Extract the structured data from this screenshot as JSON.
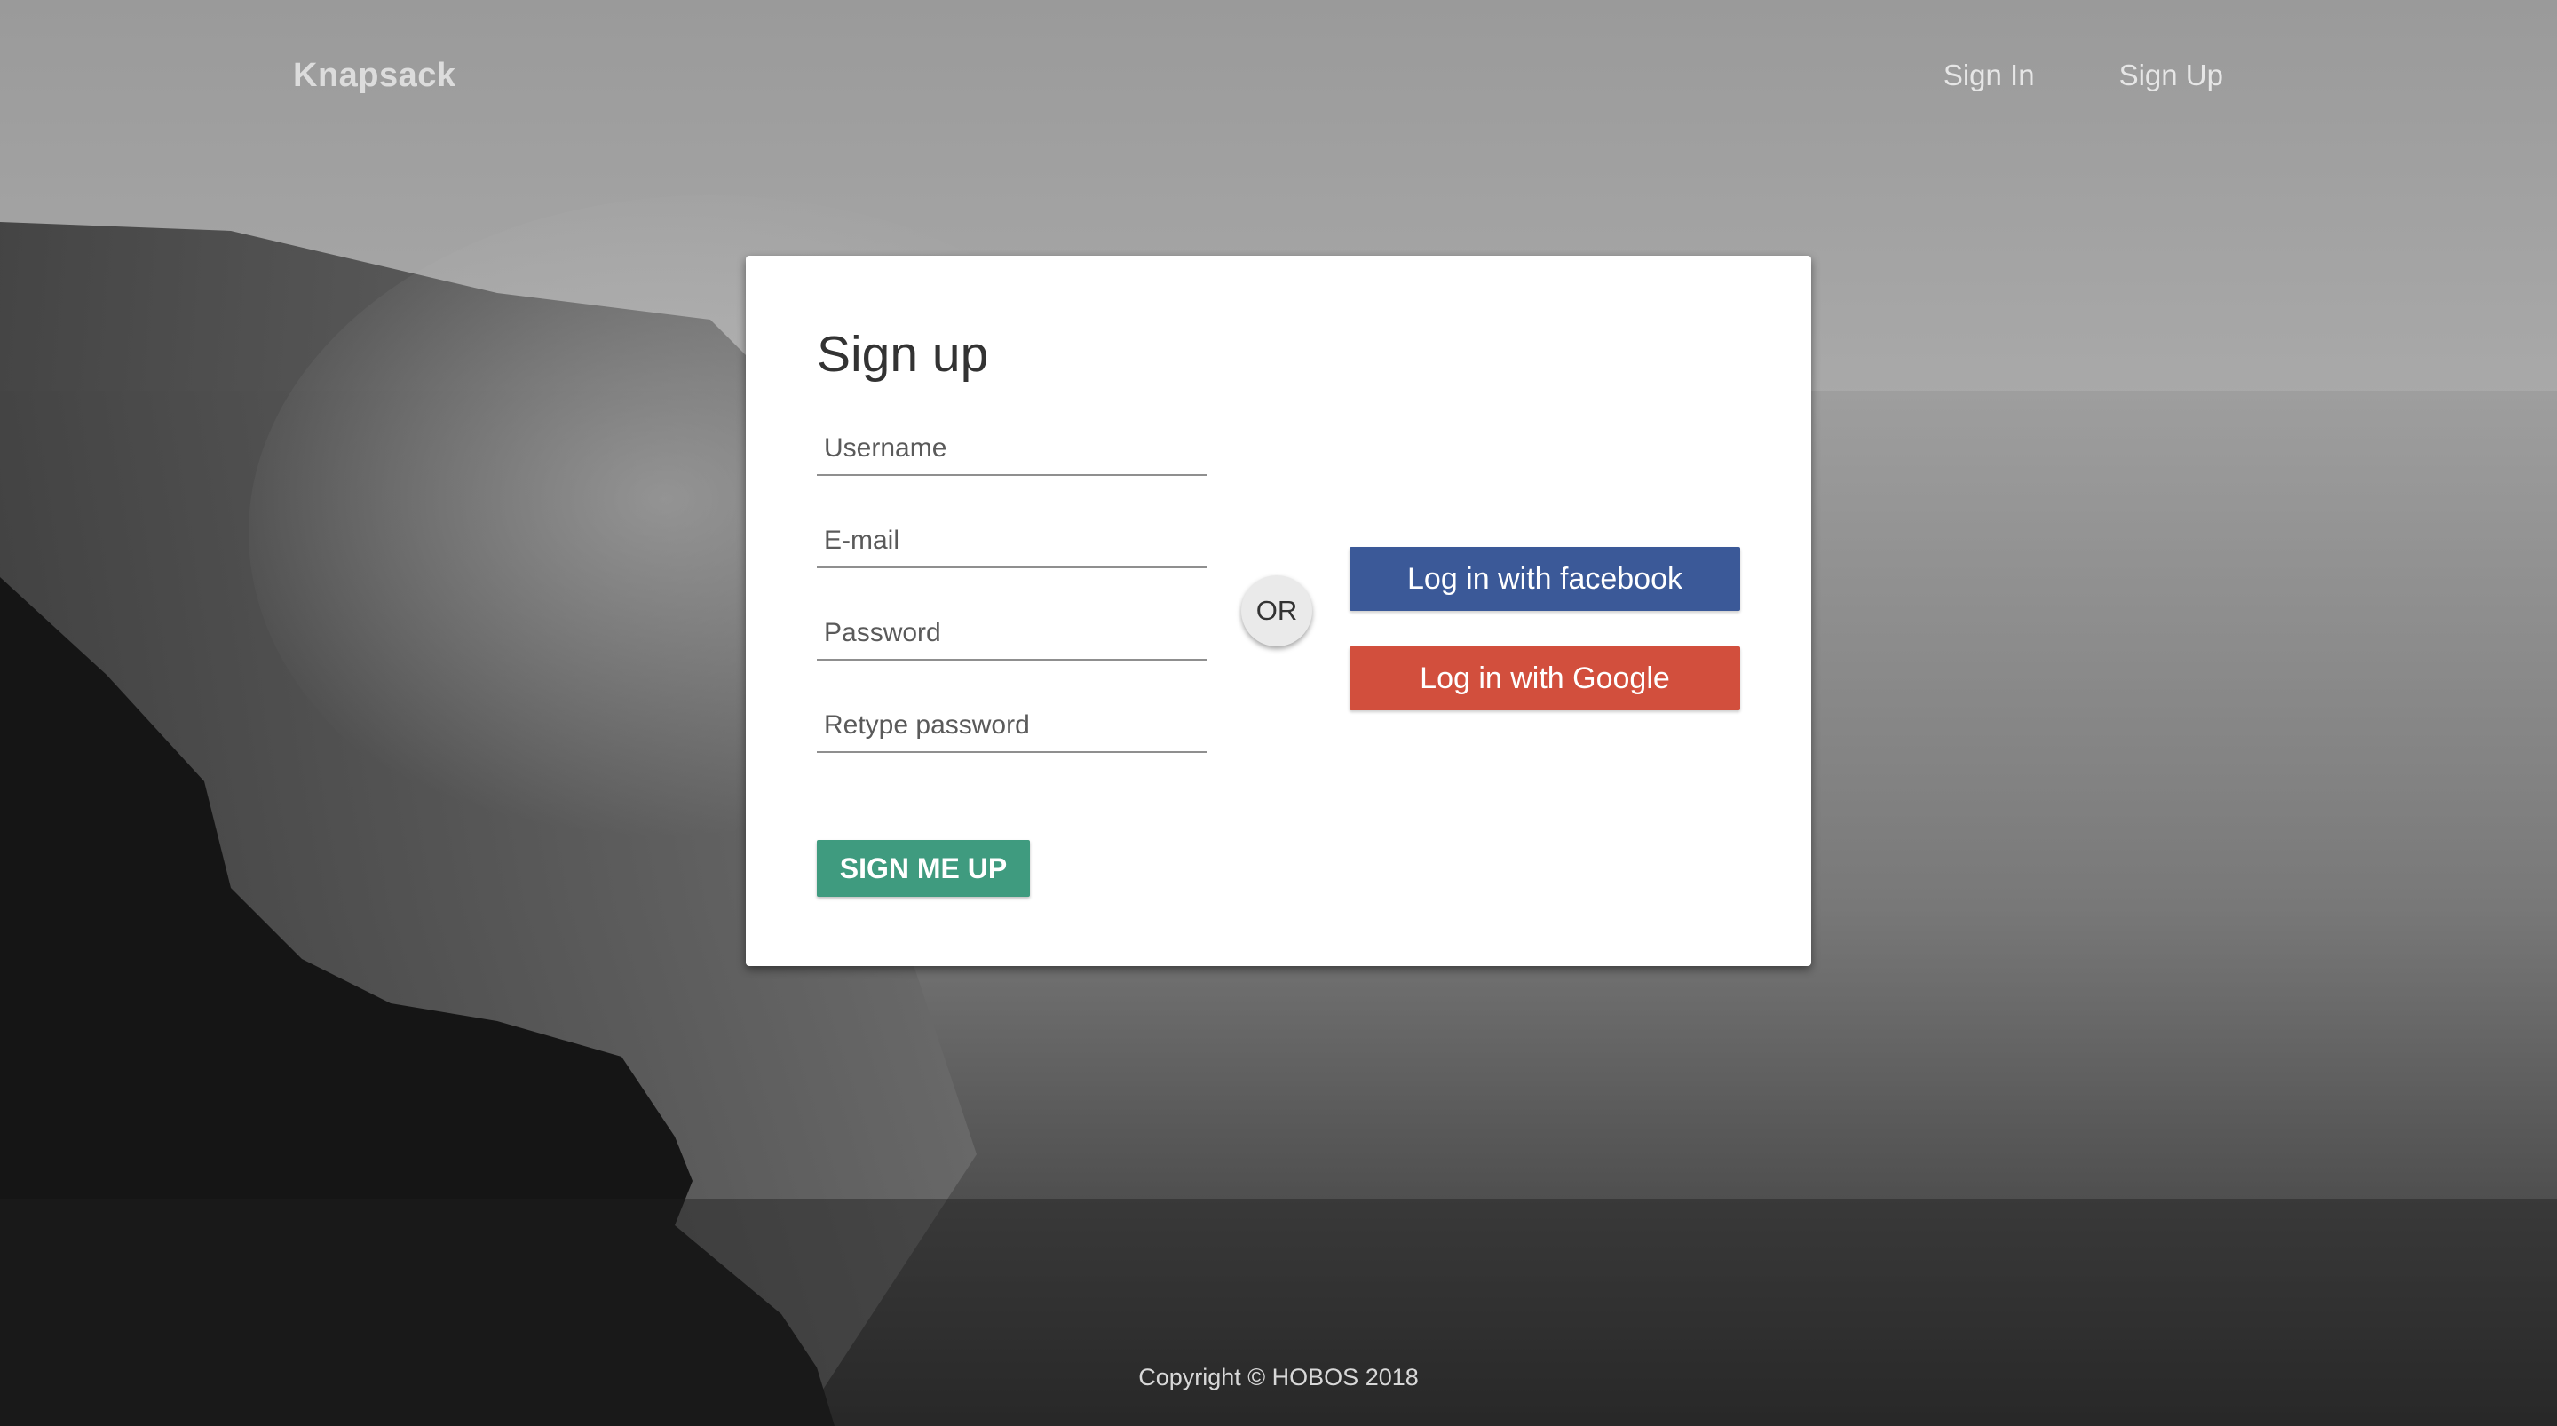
{
  "header": {
    "brand": "Knapsack",
    "nav": {
      "sign_in": "Sign In",
      "sign_up": "Sign Up"
    }
  },
  "form": {
    "title": "Sign up",
    "fields": {
      "username_placeholder": "Username",
      "email_placeholder": "E-mail",
      "password_placeholder": "Password",
      "retype_placeholder": "Retype password"
    },
    "submit_label": "SIGN ME UP",
    "divider_label": "OR",
    "facebook_label": "Log in with facebook",
    "google_label": "Log in with Google"
  },
  "footer": {
    "copyright": "Copyright © HOBOS 2018"
  },
  "colors": {
    "submit": "#3f9b7f",
    "facebook": "#3b5998",
    "google": "#d24f3d"
  }
}
